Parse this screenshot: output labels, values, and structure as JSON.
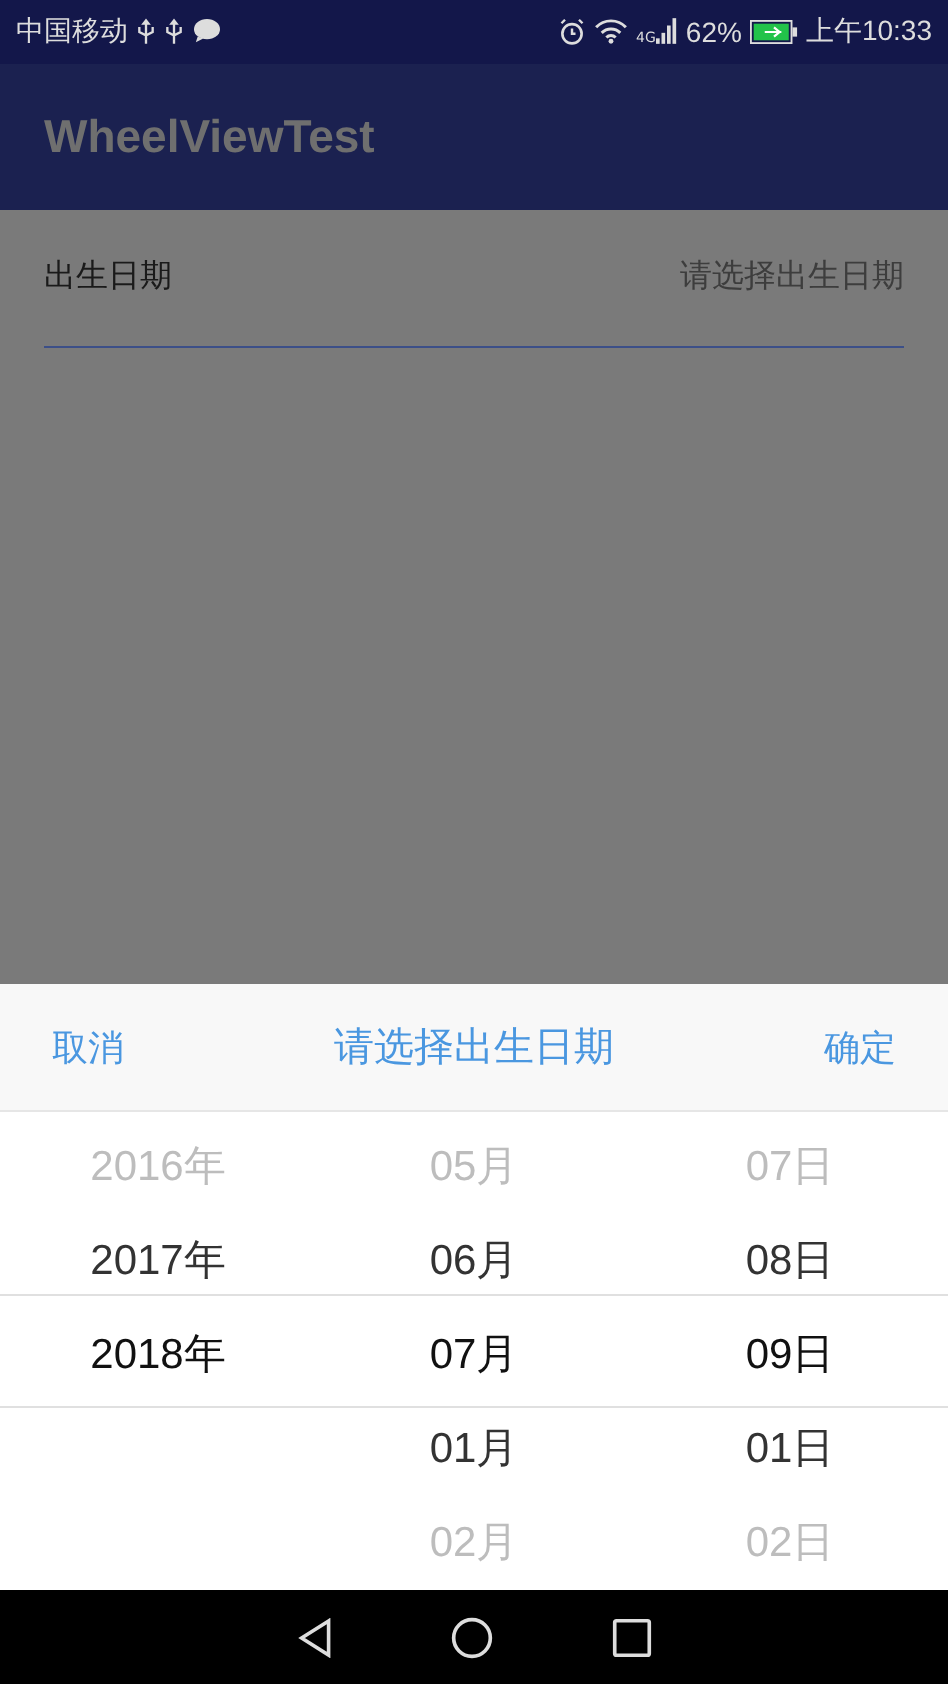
{
  "status_bar": {
    "carrier": "中国移动",
    "network": "4G",
    "battery": "62%",
    "time": "上午10:33"
  },
  "app_bar": {
    "title": "WheelViewTest"
  },
  "form": {
    "label": "出生日期",
    "placeholder": "请选择出生日期"
  },
  "picker": {
    "cancel": "取消",
    "title": "请选择出生日期",
    "confirm": "确定",
    "columns": [
      {
        "items": [
          {
            "text": "2016年",
            "selected": false
          },
          {
            "text": "2017年",
            "selected": false
          },
          {
            "text": "2018年",
            "selected": true
          }
        ]
      },
      {
        "items": [
          {
            "text": "05月",
            "selected": false
          },
          {
            "text": "06月",
            "selected": false
          },
          {
            "text": "07月",
            "selected": true
          },
          {
            "text": "01月",
            "selected": false
          },
          {
            "text": "02月",
            "selected": false
          }
        ]
      },
      {
        "items": [
          {
            "text": "07日",
            "selected": false
          },
          {
            "text": "08日",
            "selected": false
          },
          {
            "text": "09日",
            "selected": true
          },
          {
            "text": "01日",
            "selected": false
          },
          {
            "text": "02日",
            "selected": false
          }
        ]
      }
    ]
  }
}
